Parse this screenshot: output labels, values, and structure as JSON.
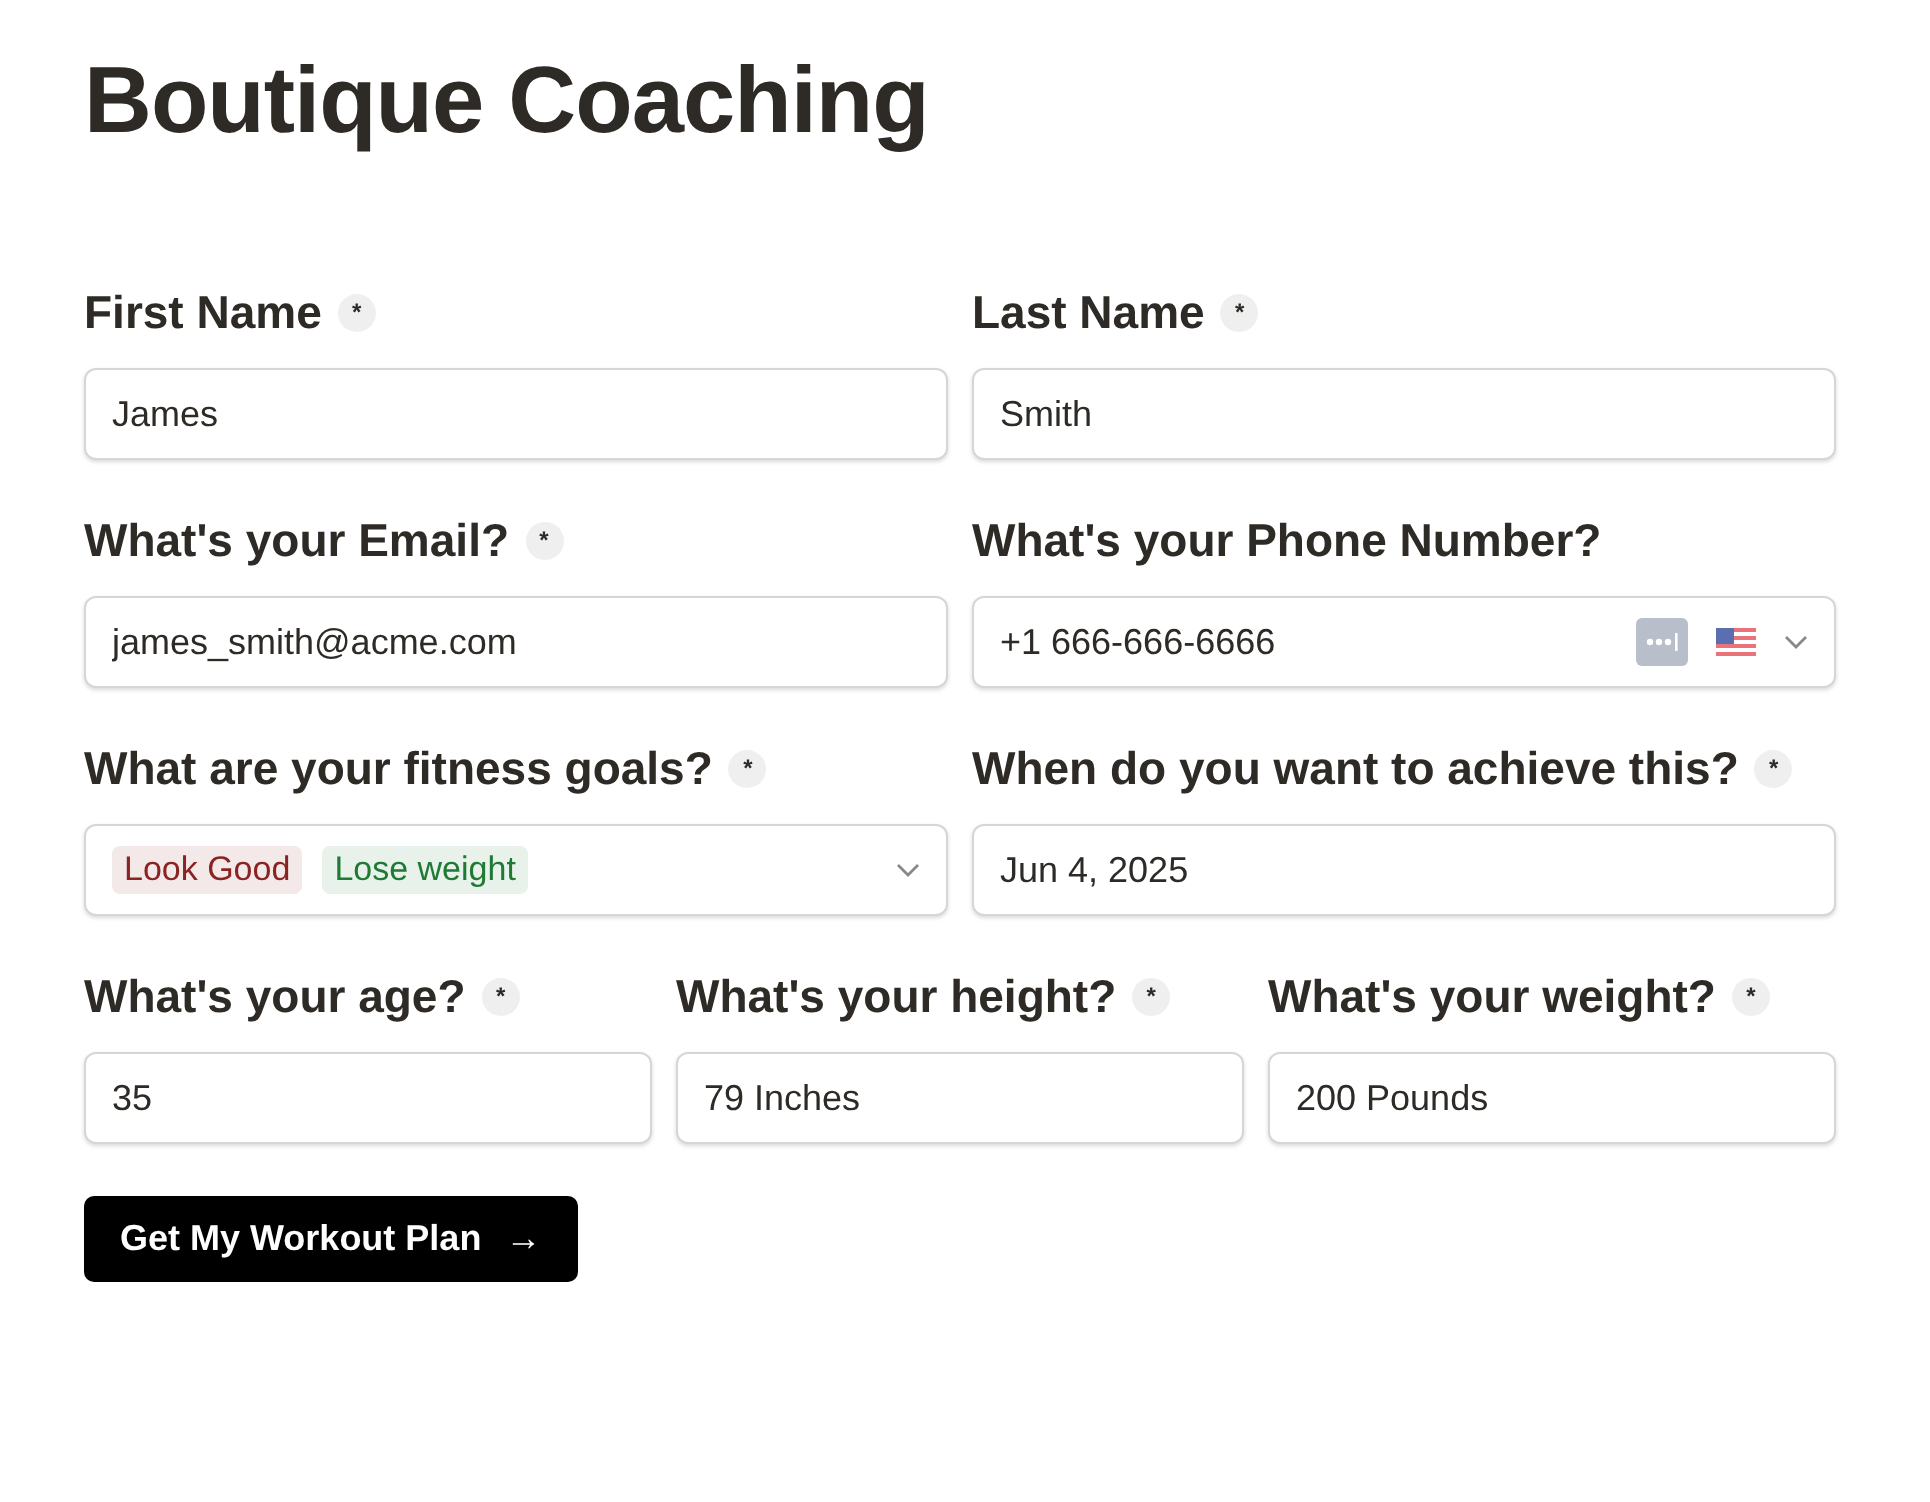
{
  "title": "Boutique Coaching",
  "rows": [
    [
      {
        "kind": "text",
        "label": "First Name",
        "required_mark": "*",
        "value": "James"
      },
      {
        "kind": "text",
        "label": "Last Name",
        "required_mark": "*",
        "value": "Smith"
      }
    ],
    [
      {
        "kind": "text",
        "label": "What's your Email?",
        "required_mark": "*",
        "value": "james_smith@acme.com"
      },
      {
        "kind": "phone",
        "label": "What's your Phone Number?",
        "value": "+1 666-666-6666"
      }
    ],
    [
      {
        "kind": "tags",
        "label": "What are your fitness goals?",
        "required_mark": "*",
        "tags": [
          {
            "label": "Look Good",
            "color": "#8b2323"
          },
          {
            "label": "Lose weight",
            "color": "#1f7a34"
          }
        ]
      },
      {
        "kind": "text",
        "label": "When do you want to achieve this?",
        "required_mark": "*",
        "value": "Jun 4, 2025"
      }
    ],
    [
      {
        "kind": "text",
        "label": "What's your age?",
        "required_mark": "*",
        "value": "35"
      },
      {
        "kind": "text",
        "label": "What's your height?",
        "required_mark": "*",
        "value": "79 Inches"
      },
      {
        "kind": "text",
        "label": "What's your weight?",
        "required_mark": "*",
        "value": "200 Pounds"
      }
    ]
  ],
  "submit": {
    "label": "Get My Workout Plan",
    "icon": "→"
  }
}
